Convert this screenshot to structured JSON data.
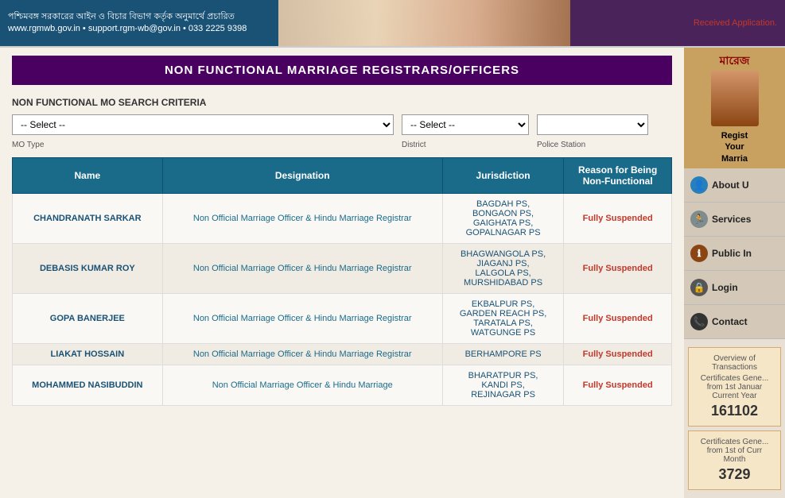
{
  "header": {
    "left_text": "পশ্চিমবঙ্গ সরকারের আইন ও বিচার বিভাগ কর্তৃক অনুমার্থে প্রচারিত\nwww.rgmwb.gov.in • support.rgm-wb@gov.in • 033 2225 9398",
    "notification": "Received Application."
  },
  "page_title": "NON FUNCTIONAL MARRIAGE REGISTRARS/OFFICERS",
  "search": {
    "label": "NON FUNCTIONAL MO SEARCH CRITERIA",
    "mo_type_placeholder": "-- Select --",
    "district_placeholder": "-- Select --",
    "ps_placeholder": "",
    "mo_type_label": "MO Type",
    "district_label": "District",
    "ps_label": "Police Station"
  },
  "table": {
    "headers": [
      "Name",
      "Designation",
      "Jurisdiction",
      "Reason for Being Non-Functional"
    ],
    "rows": [
      {
        "name": "CHANDRANATH SARKAR",
        "designation": "Non Official Marriage Officer & Hindu Marriage Registrar",
        "jurisdiction": "BAGDAH PS,\nBONGAON PS,\nGAIGHATA PS,\nGOPALNAGAR PS",
        "reason": "Fully Suspended"
      },
      {
        "name": "DEBASIS KUMAR ROY",
        "designation": "Non Official Marriage Officer & Hindu Marriage Registrar",
        "jurisdiction": "BHAGWANGOLA PS,\nJIAGANJ PS,\nLALGOLA PS,\nMURSHIDABAD PS",
        "reason": "Fully Suspended"
      },
      {
        "name": "GOPA BANERJEE",
        "designation": "Non Official Marriage Officer & Hindu Marriage Registrar",
        "jurisdiction": "EKBALPUR PS,\nGARDEN REACH PS,\nTARATALA PS,\nWATGUNGE PS",
        "reason": "Fully Suspended"
      },
      {
        "name": "LIAKAT HOSSAIN",
        "designation": "Non Official Marriage Officer & Hindu Marriage Registrar",
        "jurisdiction": "BERHAMPORE PS",
        "reason": "Fully Suspended"
      },
      {
        "name": "MOHAMMED NASIBUDDIN",
        "designation": "Non Official Marriage Officer & Hindu Marriage",
        "jurisdiction": "BHARATPUR PS,\nKANDI PS,\nREJINAGAR PS",
        "reason": "Fully Suspended"
      }
    ]
  },
  "sidebar": {
    "bangla_text": "মারেজ",
    "regist_text": "Regist Your Marria",
    "menu_items": [
      {
        "label": "About U",
        "icon": "person-icon"
      },
      {
        "label": "Services",
        "icon": "person-running-icon"
      },
      {
        "label": "Public In",
        "icon": "info-icon"
      },
      {
        "label": "Login",
        "icon": "lock-icon"
      },
      {
        "label": "Contact",
        "icon": "phone-icon"
      }
    ],
    "stats": [
      {
        "title": "Overview of Transactions",
        "subtitle": "Certificates Gene... from 1st Januar Current Year",
        "number": "161102"
      },
      {
        "title": "Certificates Gene... from 1st of Curr Month",
        "number": "3729"
      }
    ]
  }
}
